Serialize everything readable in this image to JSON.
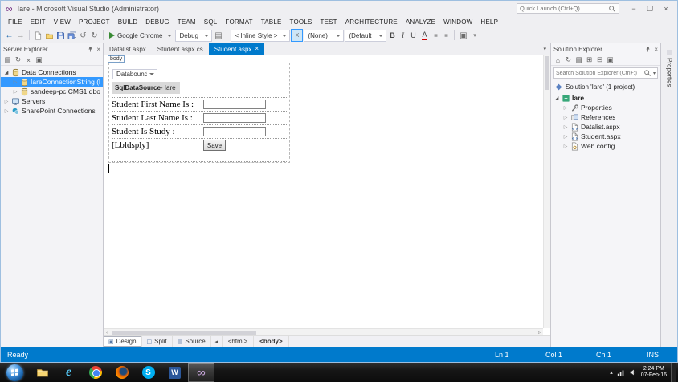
{
  "window": {
    "title": "Iare - Microsoft Visual Studio (Administrator)",
    "quick_launch_placeholder": "Quick Launch (Ctrl+Q)"
  },
  "menu": {
    "items": [
      "FILE",
      "EDIT",
      "VIEW",
      "PROJECT",
      "BUILD",
      "DEBUG",
      "TEAM",
      "SQL",
      "FORMAT",
      "TABLE",
      "TOOLS",
      "TEST",
      "ARCHITECTURE",
      "ANALYZE",
      "WINDOW",
      "HELP"
    ]
  },
  "toolbar": {
    "run_target": "Google Chrome",
    "configuration": "Debug",
    "style_dropdown": "< Inline Style >",
    "target_rule": "(None)",
    "font_dropdown": "(Default",
    "bold": "B",
    "italic": "I",
    "underline": "U",
    "font_color": "A"
  },
  "server_explorer": {
    "title": "Server Explorer",
    "items": [
      {
        "label": "Data Connections",
        "level": 0,
        "expanded": true,
        "icon": "db"
      },
      {
        "label": "IareConnectionString (l",
        "level": 1,
        "expanded": false,
        "icon": "db",
        "selected": true
      },
      {
        "label": "sandeep-pc.CMS1.dbo",
        "level": 1,
        "expanded": false,
        "icon": "db"
      },
      {
        "label": "Servers",
        "level": 0,
        "expanded": false,
        "icon": "server"
      },
      {
        "label": "SharePoint Connections",
        "level": 0,
        "expanded": false,
        "icon": "sharepoint"
      }
    ]
  },
  "editor": {
    "tabs": [
      {
        "label": "Datalist.aspx",
        "active": false
      },
      {
        "label": "Student.aspx.cs",
        "active": false
      },
      {
        "label": "Student.aspx",
        "active": true
      }
    ],
    "tag_label": "body",
    "design": {
      "databound_dropdown": "Databound",
      "datasource_bold": "SqlDataSource",
      "datasource_rest": " - Iare",
      "field_rows": [
        {
          "label": "Student First Name Is :"
        },
        {
          "label": "Student Last Name Is :"
        },
        {
          "label": "Student Is Study :"
        }
      ],
      "display_label": "[Lbldsply]",
      "save_button": "Save"
    },
    "view_modes": [
      {
        "label": "Design",
        "active": true,
        "icon": "design_mode"
      },
      {
        "label": "Split",
        "active": false,
        "icon": "split_mode"
      },
      {
        "label": "Source",
        "active": false,
        "icon": "source_mode"
      }
    ],
    "tag_breadcrumbs": [
      "<html>",
      "<body>"
    ]
  },
  "solution_explorer": {
    "title": "Solution Explorer",
    "search_placeholder": "Search Solution Explorer (Ctrl+;)",
    "solution_label": "Solution 'Iare' (1 project)",
    "items": [
      {
        "label": "Iare",
        "level": 0,
        "expanded": true,
        "icon": "project",
        "bold": true
      },
      {
        "label": "Properties",
        "level": 1,
        "expanded": false,
        "icon": "properties"
      },
      {
        "label": "References",
        "level": 1,
        "expanded": false,
        "icon": "references"
      },
      {
        "label": "Datalist.aspx",
        "level": 1,
        "expanded": false,
        "icon": "aspx"
      },
      {
        "label": "Student.aspx",
        "level": 1,
        "expanded": false,
        "icon": "aspx"
      },
      {
        "label": "Web.config",
        "level": 1,
        "expanded": false,
        "icon": "config"
      }
    ]
  },
  "properties_panel_tab": "Properties",
  "status_bar": {
    "message": "Ready",
    "line": "Ln 1",
    "column": "Col 1",
    "character": "Ch 1",
    "mode": "INS"
  },
  "taskbar": {
    "apps": [
      {
        "name": "start",
        "icon": "windows-start",
        "active": false
      },
      {
        "name": "file-explorer",
        "icon": "folder",
        "active": false
      },
      {
        "name": "internet-explorer",
        "icon": "ie",
        "active": false
      },
      {
        "name": "chrome",
        "icon": "chrome",
        "active": false
      },
      {
        "name": "firefox",
        "icon": "firefox",
        "active": false
      },
      {
        "name": "skype",
        "icon": "skype",
        "active": false
      },
      {
        "name": "word",
        "icon": "word",
        "active": false
      },
      {
        "name": "visual-studio",
        "icon": "visual-studio",
        "active": true
      }
    ],
    "clock": {
      "time": "2:24 PM",
      "date": "07-Feb-16"
    }
  },
  "icons": {
    "vs_logo": "∞",
    "back": "←",
    "forward": "→",
    "undo": "↺",
    "redo": "↻",
    "dropdown_caret": "▾",
    "overflow_caret": "▾",
    "close": "×",
    "minimize": "−",
    "maximize": "▢",
    "tray_up": "▴",
    "crumb_back": "◂",
    "scroll_left": "◃",
    "scroll_right": "▹",
    "align": "≡",
    "home": "⌂",
    "refresh": "↻",
    "grid": "▤",
    "collapse_all": "⊟",
    "expand_all": "⊞",
    "box": "▣",
    "target_rule": "X",
    "design_mode": "▣",
    "split_mode": "◫",
    "source_mode": "▤"
  },
  "colors": {
    "accent_blue": "#007acc",
    "selection_blue": "#3399ff",
    "panel_bg": "#efeff2",
    "taskbar_bg": "#161616",
    "vs_purple": "#68217a"
  }
}
